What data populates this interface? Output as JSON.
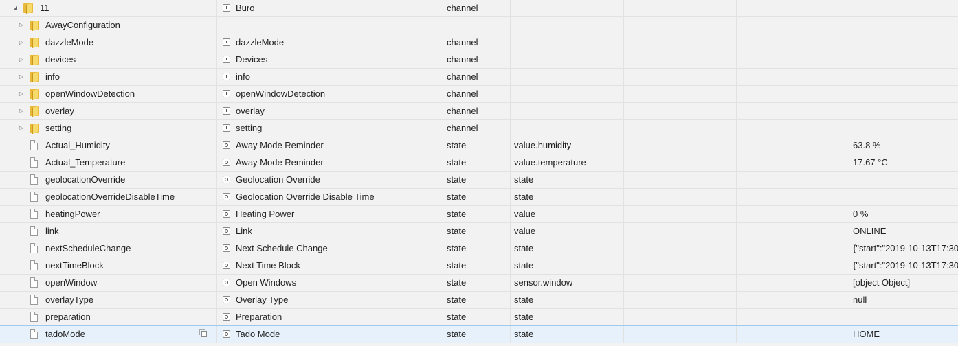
{
  "rows": [
    {
      "id": "11",
      "name": "Büro",
      "type": "channel",
      "role": "",
      "value": ""
    },
    {
      "id": "AwayConfiguration",
      "name": "",
      "type": "",
      "role": "",
      "value": ""
    },
    {
      "id": "dazzleMode",
      "name": "dazzleMode",
      "type": "channel",
      "role": "",
      "value": ""
    },
    {
      "id": "devices",
      "name": "Devices",
      "type": "channel",
      "role": "",
      "value": ""
    },
    {
      "id": "info",
      "name": "info",
      "type": "channel",
      "role": "",
      "value": ""
    },
    {
      "id": "openWindowDetection",
      "name": "openWindowDetection",
      "type": "channel",
      "role": "",
      "value": ""
    },
    {
      "id": "overlay",
      "name": "overlay",
      "type": "channel",
      "role": "",
      "value": ""
    },
    {
      "id": "setting",
      "name": "setting",
      "type": "channel",
      "role": "",
      "value": ""
    },
    {
      "id": "Actual_Humidity",
      "name": "Away Mode Reminder",
      "type": "state",
      "role": "value.humidity",
      "value": "63.8 %"
    },
    {
      "id": "Actual_Temperature",
      "name": "Away Mode Reminder",
      "type": "state",
      "role": "value.temperature",
      "value": "17.67 °C"
    },
    {
      "id": "geolocationOverride",
      "name": "Geolocation Override",
      "type": "state",
      "role": "state",
      "value": ""
    },
    {
      "id": "geolocationOverrideDisableTime",
      "name": "Geolocation Override Disable Time",
      "type": "state",
      "role": "state",
      "value": ""
    },
    {
      "id": "heatingPower",
      "name": "Heating Power",
      "type": "state",
      "role": "value",
      "value": "0 %"
    },
    {
      "id": "link",
      "name": "Link",
      "type": "state",
      "role": "value",
      "value": "ONLINE"
    },
    {
      "id": "nextScheduleChange",
      "name": "Next Schedule Change",
      "type": "state",
      "role": "state",
      "value": "{\"start\":\"2019-10-13T17:30:"
    },
    {
      "id": "nextTimeBlock",
      "name": "Next Time Block",
      "type": "state",
      "role": "state",
      "value": "{\"start\":\"2019-10-13T17:30:"
    },
    {
      "id": "openWindow",
      "name": "Open Windows",
      "type": "state",
      "role": "sensor.window",
      "value": "[object Object]"
    },
    {
      "id": "overlayType",
      "name": "Overlay Type",
      "type": "state",
      "role": "state",
      "value": "null"
    },
    {
      "id": "preparation",
      "name": "Preparation",
      "type": "state",
      "role": "state",
      "value": ""
    },
    {
      "id": "tadoMode",
      "name": "Tado Mode",
      "type": "state",
      "role": "state",
      "value": "HOME"
    }
  ]
}
